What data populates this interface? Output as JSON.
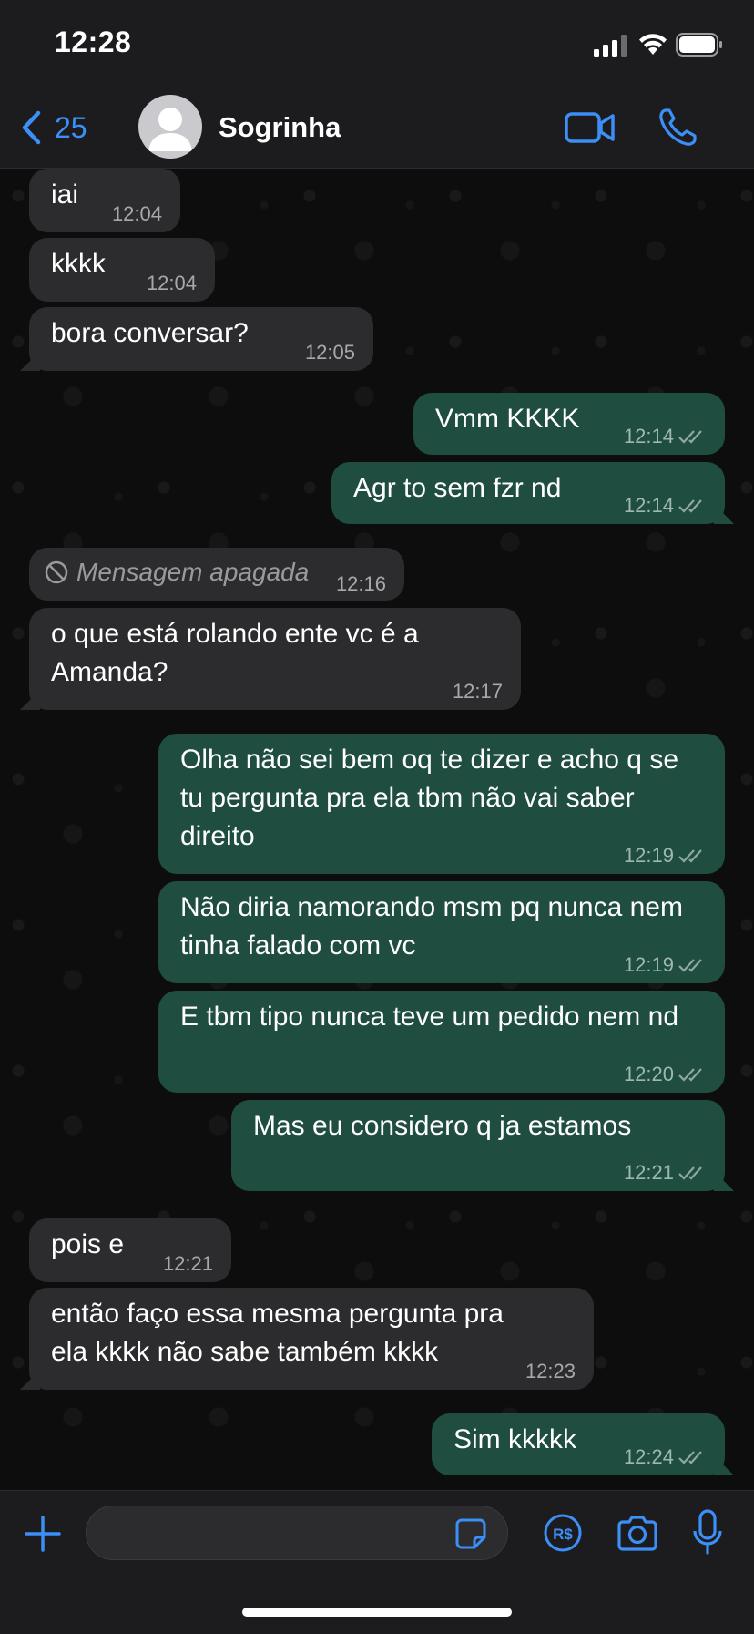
{
  "status_bar": {
    "time": "12:28"
  },
  "header": {
    "back_count": "25",
    "contact_name": "Sogrinha"
  },
  "colors": {
    "accent": "#3c8ff7",
    "incoming_bubble": "#2c2c2e",
    "outgoing_bubble": "#1f4d40",
    "background": "#0d0d0d"
  },
  "messages": [
    {
      "dir": "in",
      "text": "iai",
      "time": "12:04"
    },
    {
      "dir": "in",
      "text": "kkkk",
      "time": "12:04"
    },
    {
      "dir": "in",
      "text": "bora conversar?",
      "time": "12:05"
    },
    {
      "dir": "out",
      "text": "Vmm KKKK",
      "time": "12:14"
    },
    {
      "dir": "out",
      "text": "Agr to sem fzr nd",
      "time": "12:14"
    },
    {
      "dir": "in",
      "text": "Mensagem apagada",
      "time": "12:16",
      "deleted": true
    },
    {
      "dir": "in",
      "text": "o que está rolando ente vc é a Amanda?",
      "time": "12:17"
    },
    {
      "dir": "out",
      "text": "Olha não sei bem oq te dizer e acho q se tu pergunta pra ela tbm não vai saber direito",
      "time": "12:19"
    },
    {
      "dir": "out",
      "text": "Não diria namorando msm pq nunca nem tinha falado com vc",
      "time": "12:19"
    },
    {
      "dir": "out",
      "text": "E tbm tipo nunca teve um pedido nem nd",
      "time": "12:20"
    },
    {
      "dir": "out",
      "text": "Mas eu considero q ja estamos",
      "time": "12:21"
    },
    {
      "dir": "in",
      "text": "pois e",
      "time": "12:21"
    },
    {
      "dir": "in",
      "text": "então faço essa mesma pergunta pra ela kkkk não sabe também kkkk",
      "time": "12:23"
    },
    {
      "dir": "out",
      "text": "Sim kkkkk",
      "time": "12:24"
    }
  ],
  "icons": {
    "back": "chevron-left-icon",
    "video": "video-camera-icon",
    "call": "phone-icon",
    "plus": "plus-icon",
    "sticker": "sticker-icon",
    "pay": "real-currency-icon",
    "camera": "camera-icon",
    "mic": "microphone-icon"
  }
}
